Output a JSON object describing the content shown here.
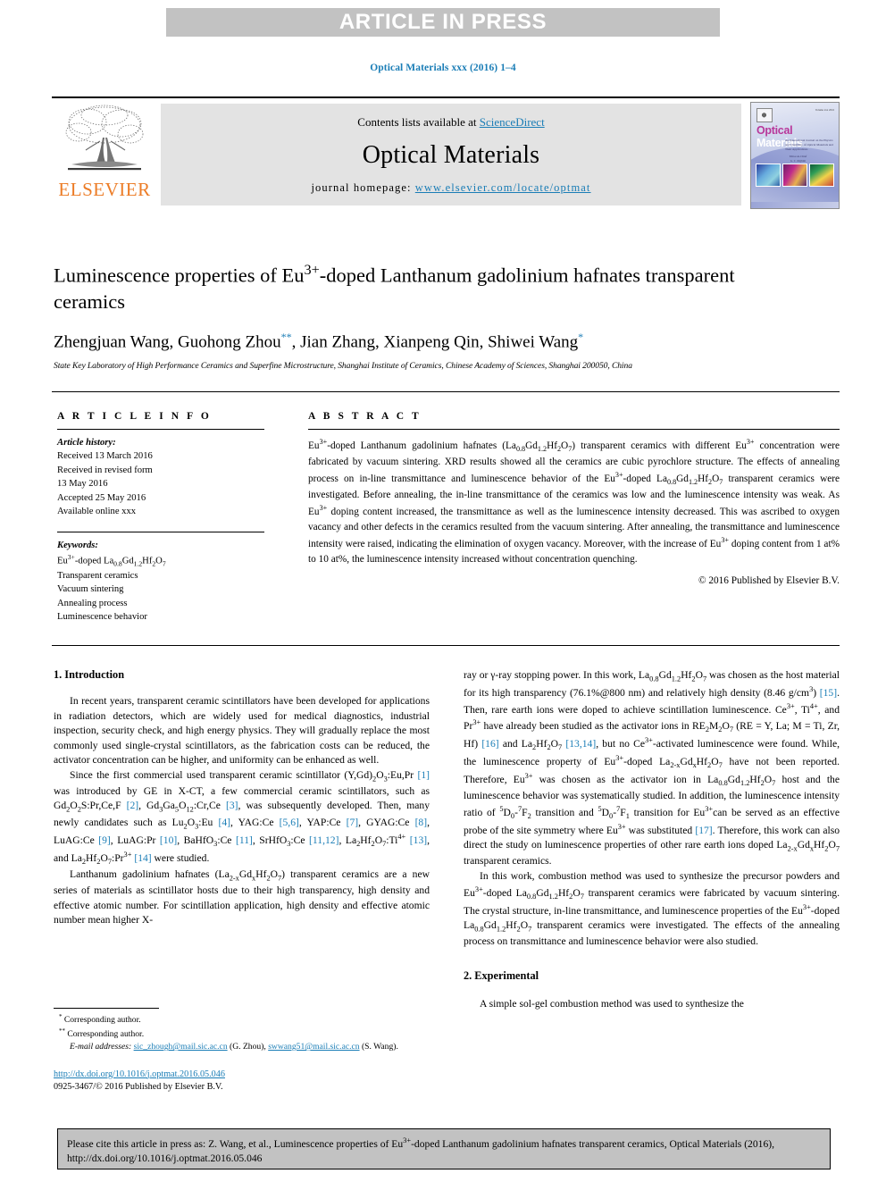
{
  "banner": {
    "text": "ARTICLE IN PRESS"
  },
  "journal_ref": "Optical Materials xxx (2016) 1–4",
  "masthead": {
    "contents_prefix": "Contents lists available at ",
    "sciencedirect": "ScienceDirect",
    "journal_name": "Optical Materials",
    "homepage_label": "journal homepage: ",
    "homepage_url": "www.elsevier.com/locate/optmat",
    "publisher": "ELSEVIER",
    "cover_title_1": "Optical",
    "cover_title_2": "Materials"
  },
  "article": {
    "title_line1": "Luminescence properties of Eu",
    "title_sup": "3+",
    "title_line1b": "-doped Lanthanum gadolinium",
    "title_line2": "hafnates transparent ceramics",
    "authors_a": "Zhengjuan Wang, Guohong Zhou",
    "authors_b": ", Jian Zhang, Xianpeng Qin, Shiwei Wang",
    "affiliation": "State Key Laboratory of High Performance Ceramics and Superfine Microstructure, Shanghai Institute of Ceramics, Chinese Academy of Sciences, Shanghai 200050, China"
  },
  "info": {
    "heading": "A R T I C L E   I N F O",
    "history_label": "Article history:",
    "history": [
      "Received 13 March 2016",
      "Received in revised form",
      "13 May 2016",
      "Accepted 25 May 2016",
      "Available online xxx"
    ],
    "keywords_label": "Keywords:",
    "keywords": [
      "Transparent ceramics",
      "Vacuum sintering",
      "Annealing process",
      "Luminescence behavior"
    ],
    "keyword_first_pre": "Eu",
    "keyword_first_sup": "3+",
    "keyword_first_post": "-doped La"
  },
  "abstract": {
    "heading": "A B S T R A C T",
    "text": "Eu3+-doped Lanthanum gadolinium hafnates (La0.8Gd1.2Hf2O7) transparent ceramics with different Eu3+ concentration were fabricated by vacuum sintering. XRD results showed all the ceramics are cubic pyrochlore structure. The effects of annealing process on in-line transmittance and luminescence behavior of the Eu3+-doped La0.8Gd1.2Hf2O7 transparent ceramics were investigated. Before annealing, the in-line transmittance of the ceramics was low and the luminescence intensity was weak. As Eu3+ doping content increased, the transmittance as well as the luminescence intensity decreased. This was ascribed to oxygen vacancy and other defects in the ceramics resulted from the vacuum sintering. After annealing, the transmittance and luminescence intensity were raised, indicating the elimination of oxygen vacancy. Moreover, with the increase of Eu3+ doping content from 1 at% to 10 at%, the luminescence intensity increased without concentration quenching.",
    "copyright": "© 2016 Published by Elsevier B.V."
  },
  "sections": {
    "intro_heading": "1.  Introduction",
    "experimental_heading": "2.  Experimental",
    "intro_p1": "In recent years, transparent ceramic scintillators have been developed for applications in radiation detectors, which are widely used for medical diagnostics, industrial inspection, security check, and high energy physics. They will gradually replace the most commonly used single-crystal scintillators, as the fabrication costs can be reduced, the activator concentration can be higher, and uniformity can be enhanced as well.",
    "intro_p2": "Since the first commercial used transparent ceramic scintillator (Y,Gd)2O3:Eu,Pr [1] was introduced by GE in X-CT, a few commercial ceramic scintillators, such as Gd2O2S:Pr,Ce,F [2], Gd3Ga5O12:Cr,Ce [3], was subsequently developed. Then, many newly candidates such as Lu2O3:Eu [4], YAG:Ce [5,6], YAP:Ce [7], GYAG:Ce [8], LuAG:Ce [9], LuAG:Pr [10], BaHfO3:Ce [11], SrHfO3:Ce [11,12], La2Hf2O7:Ti4+ [13], and La2Hf2O7:Pr3+ [14] were studied.",
    "intro_p3": "Lanthanum gadolinium hafnates (La2-xGdxHf2O7) transparent ceramics are a new series of materials as scintillator hosts due to their high transparency, high density and effective atomic number. For scintillation application, high density and effective atomic number mean higher X-ray or γ-ray stopping power. In this work, La0.8Gd1.2Hf2O7 was chosen as the host material for its high transparency (76.1%@800 nm) and relatively high density (8.46 g/cm3) [15]. Then, rare earth ions were doped to achieve scintillation luminescence. Ce3+, Ti4+, and Pr3+ have already been studied as the activator ions in RE2M2O7 (RE = Y, La; M = Ti, Zr, Hf) [16] and La2Hf2O7 [13,14], but no Ce3+-activated luminescence were found. While, the luminescence property of Eu3+-doped La2-xGdxHf2O7 have not been reported. Therefore, Eu3+ was chosen as the activator ion in La0.8Gd1.2Hf2O7 host and the luminescence behavior was systematically studied. In addition, the luminescence intensity ratio of 5D0-7F2 transition and 5D0-7F1 transition for Eu3+ can be served as an effective probe of the site symmetry where Eu3+ was substituted [17]. Therefore, this work can also direct the study on luminescence properties of other rare earth ions doped La2-xGdxHf2O7 transparent ceramics.",
    "intro_p4": "In this work, combustion method was used to synthesize the precursor powders and Eu3+-doped La0.8Gd1.2Hf2O7 transparent ceramics were fabricated by vacuum sintering. The crystal structure, in-line transmittance, and luminescence properties of the Eu3+-doped La0.8Gd1.2Hf2O7 transparent ceramics were investigated. The effects of the annealing process on transmittance and luminescence behavior were also studied.",
    "exp_p1": "A simple sol-gel combustion method was used to synthesize the"
  },
  "footnotes": {
    "corr1_star": "*",
    "corr1": "Corresponding author.",
    "corr2_star": "**",
    "corr2": "Corresponding author.",
    "email_label": "E-mail addresses:",
    "email1": "sic_zhough@mail.sic.ac.cn",
    "email1_owner": "(G. Zhou),",
    "email2": "swwang51@mail.sic.ac.cn",
    "email2_owner": "(S. Wang).",
    "doi": "http://dx.doi.org/10.1016/j.optmat.2016.05.046",
    "issn_line": "0925-3467/© 2016 Published by Elsevier B.V."
  },
  "citation_box": {
    "line1_pre": "Please cite this article in press as: Z. Wang, et al., Luminescence properties of Eu",
    "line1_sup": "3+",
    "line1_post": "-doped Lanthanum gadolinium hafnates transparent",
    "line2": "ceramics, Optical Materials (2016), http://dx.doi.org/10.1016/j.optmat.2016.05.046"
  },
  "colors": {
    "link": "#1a7db6",
    "banner_bg": "#c2c2c2",
    "elsevier_orange": "#ec7c26"
  }
}
